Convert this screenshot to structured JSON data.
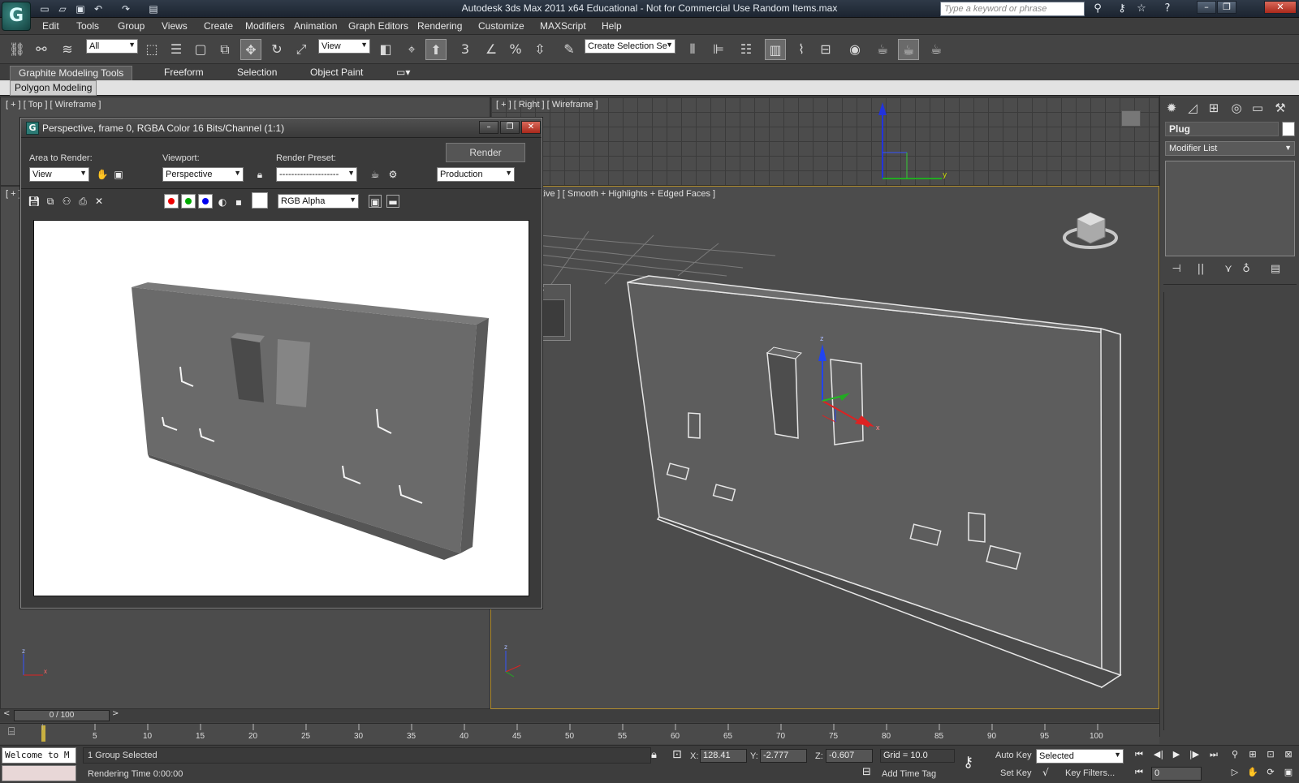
{
  "window": {
    "title": "Autodesk 3ds Max  2011 x64   Educational - Not for Commercial Use    Random Items.max",
    "search_placeholder": "Type a keyword or phrase",
    "app_logo": "G"
  },
  "menu": [
    "Edit",
    "Tools",
    "Group",
    "Views",
    "Create",
    "Modifiers",
    "Animation",
    "Graph Editors",
    "Rendering",
    "Customize",
    "MAXScript",
    "Help"
  ],
  "toolbar": {
    "selection_filter": "All",
    "ref_coord": "View",
    "named_selection": "Create Selection Se"
  },
  "ribbon": {
    "tabs": [
      "Graphite Modeling Tools",
      "Freeform",
      "Selection",
      "Object Paint"
    ],
    "panel": "Polygon Modeling"
  },
  "viewports": {
    "top": "[ + ] [ Top ] [ Wireframe ]",
    "right": "[ + ] [ Right ] [ Wireframe ]",
    "front": "[ + ]",
    "perspective": "ctive ] [ Smooth + Highlights + Edged Faces ]"
  },
  "render_window": {
    "title": "Perspective, frame 0, RGBA Color 16 Bits/Channel (1:1)",
    "area_label": "Area to Render:",
    "area_value": "View",
    "viewport_label": "Viewport:",
    "viewport_value": "Perspective",
    "preset_label": "Render Preset:",
    "preset_value": "--------------------",
    "render_button": "Render",
    "production_value": "Production",
    "channel_value": "RGB Alpha"
  },
  "command_panel": {
    "object_name": "Plug",
    "modifier_list": "Modifier List"
  },
  "timeline": {
    "position": "0 / 100",
    "ticks": [
      "5",
      "10",
      "15",
      "20",
      "25",
      "30",
      "35",
      "40",
      "45",
      "50",
      "55",
      "60",
      "65",
      "70",
      "75",
      "80",
      "85",
      "90",
      "95",
      "100"
    ]
  },
  "status": {
    "maxscript_text": "Welcome to M",
    "selection": "1 Group Selected",
    "render_time": "Rendering Time  0:00:00",
    "x_label": "X:",
    "x_value": "128.41",
    "y_label": "Y:",
    "y_value": "-2.777",
    "z_label": "Z:",
    "z_value": "-0.607",
    "grid": "Grid = 10.0",
    "add_time_tag": "Add Time Tag",
    "auto_key": "Auto Key",
    "set_key": "Set Key",
    "key_mode": "Selected",
    "key_filters": "Key Filters...",
    "frame": "0"
  },
  "colors": {
    "accent": "#b08c2e",
    "viewport_bg": "#4c4c4c",
    "render_bg": "#ffffff"
  }
}
